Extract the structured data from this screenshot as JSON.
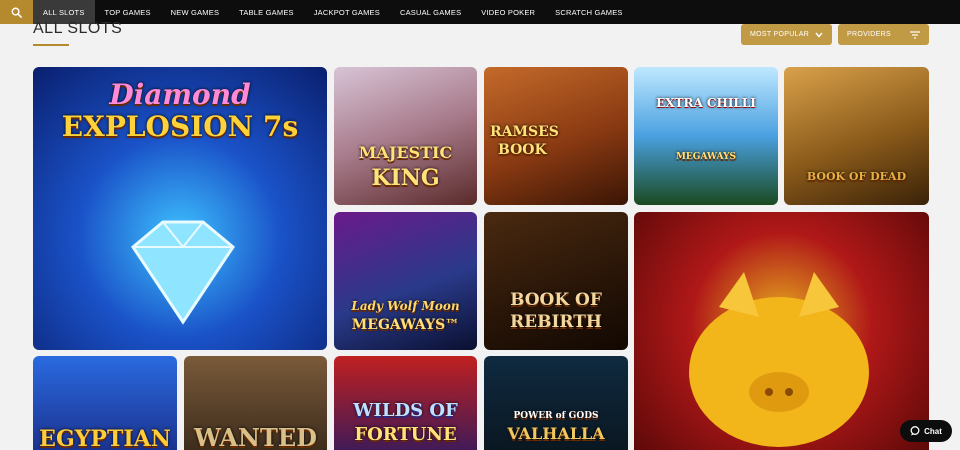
{
  "nav": {
    "search_icon": "search-icon",
    "items": [
      {
        "label": "ALL SLOTS",
        "active": true
      },
      {
        "label": "TOP GAMES"
      },
      {
        "label": "NEW GAMES"
      },
      {
        "label": "TABLE GAMES"
      },
      {
        "label": "JACKPOT GAMES"
      },
      {
        "label": "CASUAL GAMES"
      },
      {
        "label": "VIDEO POKER"
      },
      {
        "label": "SCRATCH GAMES"
      }
    ]
  },
  "header": {
    "title": "ALL SLOTS",
    "sort_label": "MOST POPULAR",
    "providers_label": "PROVIDERS"
  },
  "games": [
    {
      "title_line1": "Diamond",
      "title_line2": "EXPLOSION 7s"
    },
    {
      "title_line1": "MAJESTIC",
      "title_line2": "KING"
    },
    {
      "title_line1": "RAMSES",
      "title_line2": "BOOK"
    },
    {
      "title_line1": "EXTRA CHILLI",
      "title_line2": "MEGAWAYS"
    },
    {
      "title_line1": "",
      "title_line2": "BOOK OF DEAD"
    },
    {
      "title_line1": "Lady Wolf Moon",
      "title_line2": "MEGAWAYS™"
    },
    {
      "title_line1": "BOOK OF",
      "title_line2": "REBIRTH"
    },
    {
      "title_line1": "",
      "title_line2": ""
    },
    {
      "title_line1": "EGYPTIAN",
      "title_line2": ""
    },
    {
      "title_line1": "WANTED",
      "title_line2": ""
    },
    {
      "title_line1": "WILDS OF",
      "title_line2": "FORTUNE"
    },
    {
      "title_line1": "POWER of GODS",
      "title_line2": "VALHALLA"
    }
  ],
  "chat": {
    "label": "Chat"
  },
  "colors": {
    "accent": "#c19a45",
    "nav_bg": "#0d0d0d",
    "page_bg": "#f2f2f2"
  }
}
